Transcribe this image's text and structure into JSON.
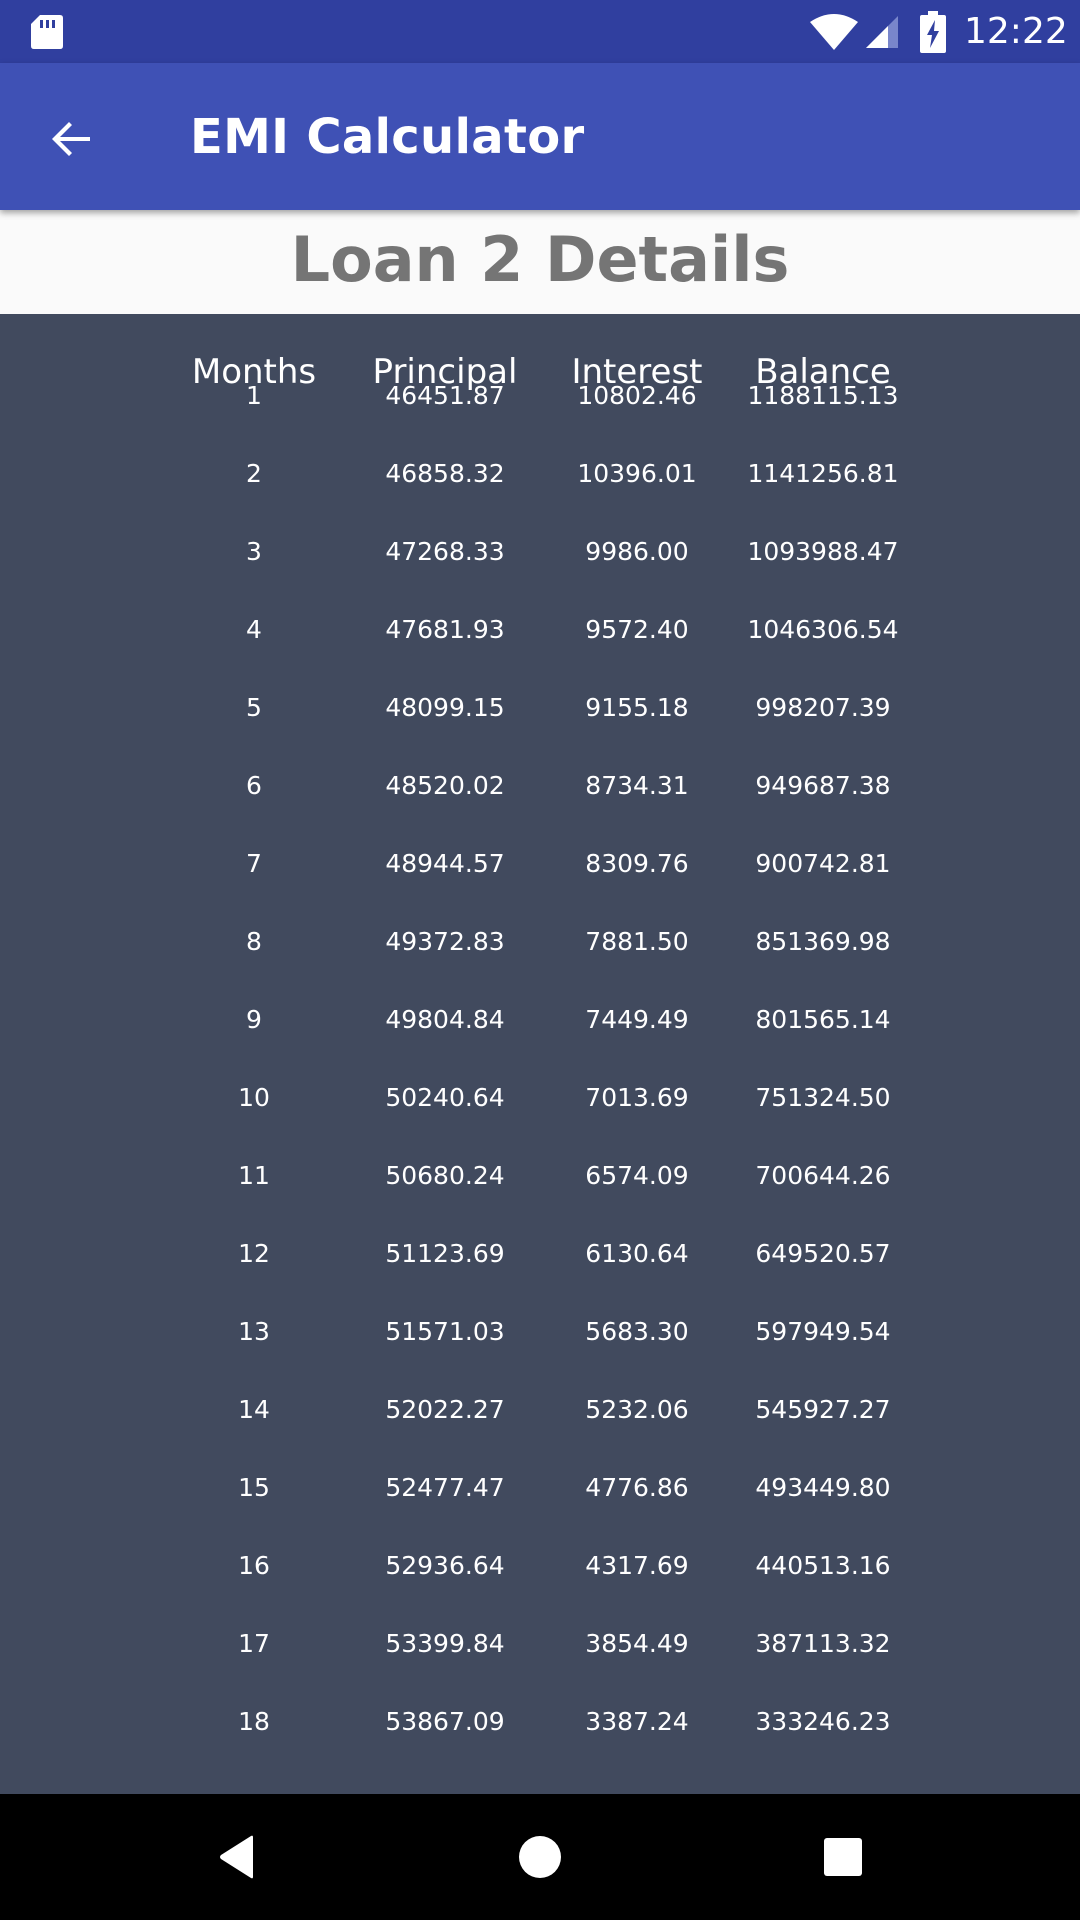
{
  "status_bar": {
    "time": "12:22",
    "icons": [
      "sd-card-icon",
      "wifi-icon",
      "cell-signal-icon",
      "battery-charging-icon"
    ]
  },
  "app_bar": {
    "title": "EMI Calculator",
    "back_icon": "arrow-back-icon"
  },
  "loan_header": {
    "title": "Loan 2 Details"
  },
  "table": {
    "columns": [
      "Months",
      "Principal",
      "Interest",
      "Balance"
    ],
    "rows": [
      [
        "1",
        "46451.87",
        "10802.46",
        "1188115.13"
      ],
      [
        "2",
        "46858.32",
        "10396.01",
        "1141256.81"
      ],
      [
        "3",
        "47268.33",
        "9986.00",
        "1093988.47"
      ],
      [
        "4",
        "47681.93",
        "9572.40",
        "1046306.54"
      ],
      [
        "5",
        "48099.15",
        "9155.18",
        "998207.39"
      ],
      [
        "6",
        "48520.02",
        "8734.31",
        "949687.38"
      ],
      [
        "7",
        "48944.57",
        "8309.76",
        "900742.81"
      ],
      [
        "8",
        "49372.83",
        "7881.50",
        "851369.98"
      ],
      [
        "9",
        "49804.84",
        "7449.49",
        "801565.14"
      ],
      [
        "10",
        "50240.64",
        "7013.69",
        "751324.50"
      ],
      [
        "11",
        "50680.24",
        "6574.09",
        "700644.26"
      ],
      [
        "12",
        "51123.69",
        "6130.64",
        "649520.57"
      ],
      [
        "13",
        "51571.03",
        "5683.30",
        "597949.54"
      ],
      [
        "14",
        "52022.27",
        "5232.06",
        "545927.27"
      ],
      [
        "15",
        "52477.47",
        "4776.86",
        "493449.80"
      ],
      [
        "16",
        "52936.64",
        "4317.69",
        "440513.16"
      ],
      [
        "17",
        "53399.84",
        "3854.49",
        "387113.32"
      ],
      [
        "18",
        "53867.09",
        "3387.24",
        "333246.23"
      ]
    ]
  },
  "nav_bar": {
    "icons": [
      "nav-back-icon",
      "nav-home-icon",
      "nav-recents-icon"
    ]
  },
  "colors": {
    "status_bar": "#303f9f",
    "app_bar": "#3f51b5",
    "table_background": "#414a5e",
    "header_background": "#fafafa",
    "header_text": "#757575",
    "nav_bar": "#000000"
  }
}
